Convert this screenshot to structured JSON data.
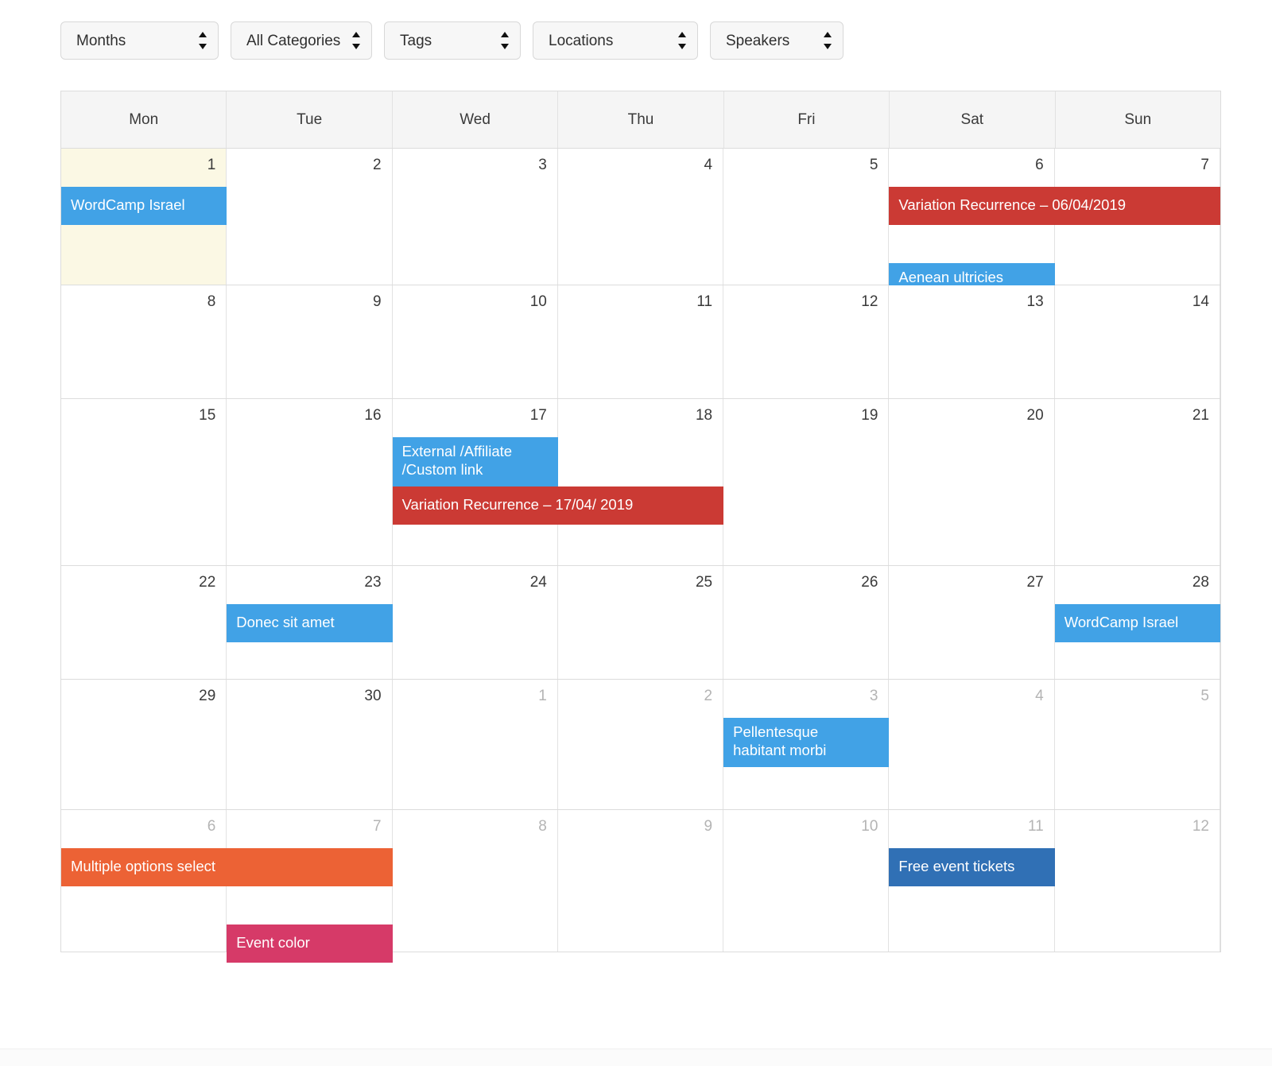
{
  "filters": [
    {
      "name": "months",
      "label": "Months",
      "icon": "updown-spinner-icon"
    },
    {
      "name": "categories",
      "label": "All Categories",
      "icon": "updown-spinner-icon"
    },
    {
      "name": "tags",
      "label": "Tags",
      "icon": "updown-spinner-icon"
    },
    {
      "name": "locations",
      "label": "Locations",
      "icon": "updown-spinner-icon"
    },
    {
      "name": "speakers",
      "label": "Speakers",
      "icon": "updown-spinner-icon"
    }
  ],
  "calendar": {
    "weekdays": [
      "Mon",
      "Tue",
      "Wed",
      "Thu",
      "Fri",
      "Sat",
      "Sun"
    ],
    "weeks": [
      {
        "days": [
          {
            "num": "1",
            "out": false,
            "today": true
          },
          {
            "num": "2",
            "out": false,
            "today": false
          },
          {
            "num": "3",
            "out": false,
            "today": false
          },
          {
            "num": "4",
            "out": false,
            "today": false
          },
          {
            "num": "5",
            "out": false,
            "today": false
          },
          {
            "num": "6",
            "out": false,
            "today": false
          },
          {
            "num": "7",
            "out": false,
            "today": false
          }
        ]
      },
      {
        "days": [
          {
            "num": "8",
            "out": false,
            "today": false
          },
          {
            "num": "9",
            "out": false,
            "today": false
          },
          {
            "num": "10",
            "out": false,
            "today": false
          },
          {
            "num": "11",
            "out": false,
            "today": false
          },
          {
            "num": "12",
            "out": false,
            "today": false
          },
          {
            "num": "13",
            "out": false,
            "today": false
          },
          {
            "num": "14",
            "out": false,
            "today": false
          }
        ]
      },
      {
        "days": [
          {
            "num": "15",
            "out": false,
            "today": false
          },
          {
            "num": "16",
            "out": false,
            "today": false
          },
          {
            "num": "17",
            "out": false,
            "today": false
          },
          {
            "num": "18",
            "out": false,
            "today": false
          },
          {
            "num": "19",
            "out": false,
            "today": false
          },
          {
            "num": "20",
            "out": false,
            "today": false
          },
          {
            "num": "21",
            "out": false,
            "today": false
          }
        ]
      },
      {
        "days": [
          {
            "num": "22",
            "out": false,
            "today": false
          },
          {
            "num": "23",
            "out": false,
            "today": false
          },
          {
            "num": "24",
            "out": false,
            "today": false
          },
          {
            "num": "25",
            "out": false,
            "today": false
          },
          {
            "num": "26",
            "out": false,
            "today": false
          },
          {
            "num": "27",
            "out": false,
            "today": false
          },
          {
            "num": "28",
            "out": false,
            "today": false
          }
        ]
      },
      {
        "days": [
          {
            "num": "29",
            "out": false,
            "today": false
          },
          {
            "num": "30",
            "out": false,
            "today": false
          },
          {
            "num": "1",
            "out": true,
            "today": false
          },
          {
            "num": "2",
            "out": true,
            "today": false
          },
          {
            "num": "3",
            "out": true,
            "today": false
          },
          {
            "num": "4",
            "out": true,
            "today": false
          },
          {
            "num": "5",
            "out": true,
            "today": false
          }
        ]
      },
      {
        "days": [
          {
            "num": "6",
            "out": true,
            "today": false
          },
          {
            "num": "7",
            "out": true,
            "today": false
          },
          {
            "num": "8",
            "out": true,
            "today": false
          },
          {
            "num": "9",
            "out": true,
            "today": false
          },
          {
            "num": "10",
            "out": true,
            "today": false
          },
          {
            "num": "11",
            "out": true,
            "today": false
          },
          {
            "num": "12",
            "out": true,
            "today": false
          }
        ]
      }
    ],
    "events": [
      {
        "title": "WordCamp Israel",
        "week": 0,
        "startCol": 0,
        "span": 1,
        "row": 0,
        "color": "#41a2e6",
        "lines": 1
      },
      {
        "title": "Variation Recurrence – 06/04/2019",
        "week": 0,
        "startCol": 5,
        "span": 2,
        "row": 0,
        "color": "#cb3a34",
        "lines": 1
      },
      {
        "title": "Aenean ultricies\nmi vitae",
        "week": 0,
        "startCol": 5,
        "span": 1,
        "row": 1,
        "color": "#41a2e6",
        "lines": 2
      },
      {
        "title": "External /Affiliate\n/Custom link",
        "week": 2,
        "startCol": 2,
        "span": 1,
        "row": 0,
        "color": "#41a2e6",
        "lines": 2
      },
      {
        "title": "Variation Recurrence – 17/04/ 2019",
        "week": 2,
        "startCol": 2,
        "span": 2,
        "row": 1,
        "color": "#cb3a34",
        "lines": 1
      },
      {
        "title": "Donec sit amet",
        "week": 3,
        "startCol": 1,
        "span": 1,
        "row": 0,
        "color": "#41a2e6",
        "lines": 1
      },
      {
        "title": "WordCamp Israel",
        "week": 3,
        "startCol": 6,
        "span": 1,
        "row": 0,
        "color": "#41a2e6",
        "lines": 1
      },
      {
        "title": "Pellentesque\nhabitant morbi",
        "week": 4,
        "startCol": 4,
        "span": 1,
        "row": 0,
        "color": "#41a2e6",
        "lines": 2
      },
      {
        "title": "Multiple options select",
        "week": 5,
        "startCol": 0,
        "span": 2,
        "row": 0,
        "color": "#ec6235",
        "lines": 1
      },
      {
        "title": "Event color",
        "week": 5,
        "startCol": 1,
        "span": 1,
        "row": 1,
        "color": "#d63a68",
        "lines": 1
      },
      {
        "title": "Free event tickets",
        "week": 5,
        "startCol": 5,
        "span": 1,
        "row": 0,
        "color": "#3070b5",
        "lines": 1
      }
    ],
    "colors": {
      "event_blue_light": "#41a2e6",
      "event_blue_dark": "#3070b5",
      "event_red": "#cb3a34",
      "event_orange": "#ec6235",
      "event_pink": "#d63a68",
      "today_highlight": "#fbf8e4",
      "grid_border": "#dcdcdc",
      "header_bg": "#f5f5f5"
    }
  }
}
